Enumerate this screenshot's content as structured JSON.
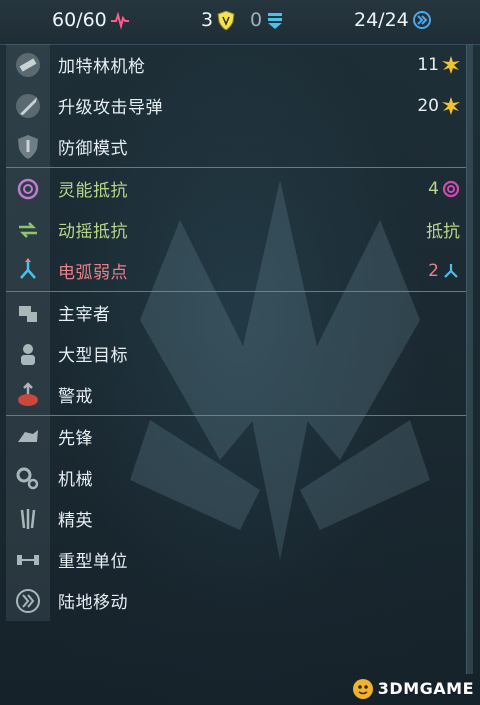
{
  "topbar": {
    "health": "60/60",
    "shield": "3",
    "armor": "0",
    "movement": "24/24",
    "colors": {
      "health": "#ff5a8a",
      "shield": "#f2e25a",
      "armor": "#4ac1ea",
      "movement": "#4aa8ea"
    }
  },
  "weapons": [
    {
      "label": "加特林机枪",
      "value": "11",
      "icon": "gatling-icon",
      "value_icon": "burst-icon"
    },
    {
      "label": "升级攻击导弹",
      "value": "20",
      "icon": "missile-icon",
      "value_icon": "burst-icon"
    },
    {
      "label": "防御模式",
      "value": "",
      "icon": "defense-icon"
    }
  ],
  "resistances": [
    {
      "label": "灵能抵抗",
      "value": "4",
      "icon": "psionic-icon",
      "value_icon": "psionic-swirl-icon",
      "color": "#b7d68a"
    },
    {
      "label": "动摇抵抗",
      "value": "抵抗",
      "icon": "stagger-icon",
      "color": "#b7d68a"
    },
    {
      "label": "电弧弱点",
      "value": "2",
      "icon": "arc-icon",
      "value_icon": "arc-triad-icon",
      "color": "#e8818a"
    }
  ],
  "traits_a": [
    {
      "label": "主宰者",
      "icon": "dominator-icon"
    },
    {
      "label": "大型目标",
      "icon": "large-target-icon"
    },
    {
      "label": "警戒",
      "icon": "alert-icon"
    }
  ],
  "traits_b": [
    {
      "label": "先锋",
      "icon": "vanguard-icon"
    },
    {
      "label": "机械",
      "icon": "gears-icon"
    },
    {
      "label": "精英",
      "icon": "elite-icon"
    },
    {
      "label": "重型单位",
      "icon": "heavy-unit-icon"
    },
    {
      "label": "陆地移动",
      "icon": "ground-move-icon"
    }
  ],
  "watermark": {
    "text": "3DMGAME"
  }
}
